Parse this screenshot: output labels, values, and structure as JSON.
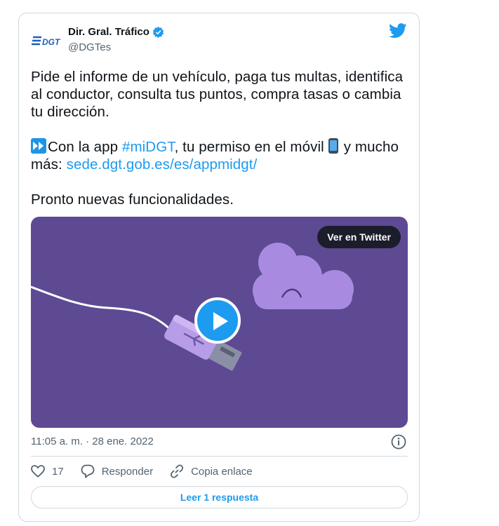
{
  "tweet": {
    "author": {
      "avatar_text": "DGT",
      "name": "Dir. Gral. Tráfico",
      "handle": "@DGTes",
      "verified_icon": "verified-badge-icon"
    },
    "text": {
      "para1": "Pide el informe de un vehículo, paga tus multas, identifica al conductor,  consulta tus puntos, compra tasas o cambia tu dirección.",
      "para2_a": "Con la app ",
      "hashtag": "#miDGT",
      "para2_b": ", tu permiso en el móvil",
      "para2_c": "y mucho más: ",
      "link": "sede.dgt.gob.es/es/appmidgt/",
      "para3": "Pronto nuevas funcionalidades."
    },
    "media": {
      "view_button": "Ver en Twitter",
      "background_color": "#5d4a93"
    },
    "timestamp": "11:05 a. m. · 28 ene. 2022",
    "actions": {
      "like_count": "17",
      "reply_label": "Responder",
      "copy_label": "Copia enlace"
    },
    "read_replies_label": "Leer 1 respuesta"
  },
  "colors": {
    "accent": "#1d9bf0",
    "text": "#0f1419",
    "muted": "#536471",
    "border": "#cfd9de"
  }
}
